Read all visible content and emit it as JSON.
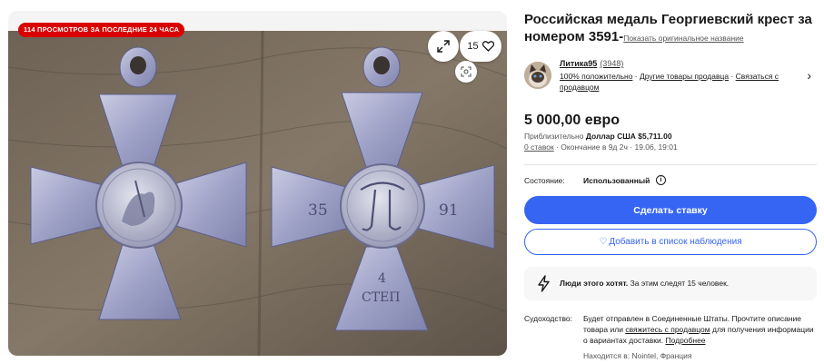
{
  "gallery": {
    "views_badge": "114 ПРОСМОТРОВ ЗА ПОСЛЕДНИЕ 24 ЧАСА",
    "watch_count": "15",
    "medal_left_marking": "35",
    "medal_right_marking": "91",
    "medal_degree_number": "4",
    "medal_degree_text": "СТЕП"
  },
  "listing": {
    "title": "Российская медаль Георгиевский крест за номером 3591-",
    "original_title_link": "Показать оригинальное название"
  },
  "seller": {
    "name": "Литика95",
    "count": "(3948)",
    "positive": "100% положительно",
    "other_items": "Другие товары продавца",
    "contact": "Связаться с продавцом"
  },
  "price": {
    "amount": "5 000,00 евро",
    "approx_prefix": "Приблизительно",
    "approx_value": "Доллар США $5,711.00",
    "bids": "0 ставок",
    "ending": "Окончание в 9д 2ч · 19.06, 19:01"
  },
  "condition": {
    "label": "Состояние:",
    "value": "Использованный",
    "info_icon": "i"
  },
  "actions": {
    "bid_label": "Сделать ставку",
    "watch_icon": "♡",
    "watch_label": "Добавить в список наблюдения"
  },
  "hot": {
    "bold": "Люди этого хотят.",
    "text": "За этим следят 15 человек."
  },
  "shipping": {
    "label": "Судоходство:",
    "text1": "Будет отправлен в Соединенные Штаты. Прочтите описание товара или",
    "link1": "свяжитесь с продавцом",
    "text2": "для получения информации о вариантах доставки.",
    "link2": "Подробнее",
    "location": "Находится в: Nointel, Франция"
  },
  "colors": {
    "accent": "#3665f3",
    "badge": "#d90000"
  }
}
